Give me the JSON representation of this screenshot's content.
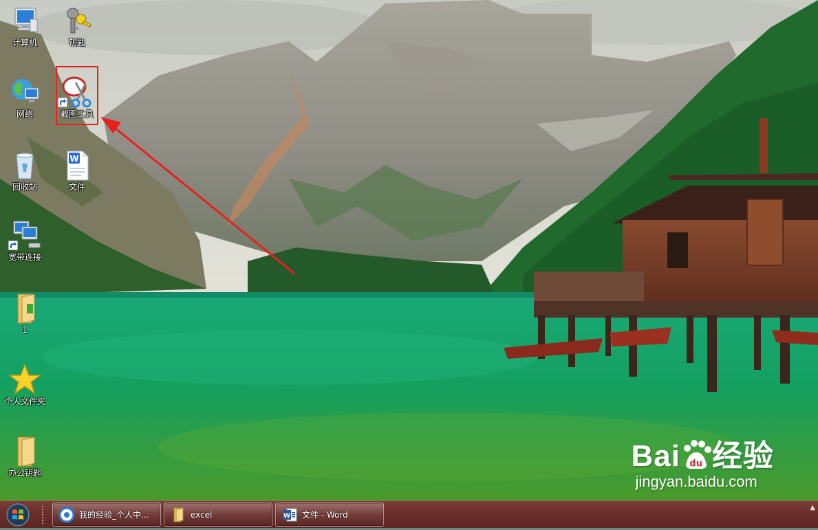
{
  "desktop": {
    "icons": [
      {
        "label": "计算机",
        "icon": "computer-icon"
      },
      {
        "label": "钥匙",
        "icon": "keys-icon"
      },
      {
        "label": "网络",
        "icon": "network-globe-icon"
      },
      {
        "label": "截图工具",
        "icon": "scissors-icon"
      },
      {
        "label": "回收站",
        "icon": "recycle-bin-icon"
      },
      {
        "label": "文件",
        "icon": "wps-word-document-icon"
      },
      {
        "label": "宽带连接",
        "icon": "broadband-connection-icon"
      },
      {
        "label": "1",
        "icon": "folder-icon"
      },
      {
        "label": "个人文件夹",
        "icon": "star-icon"
      },
      {
        "label": "办公钥匙",
        "icon": "folder-icon"
      }
    ]
  },
  "annotation": {
    "highlight_color": "#e8201e",
    "highlight_target": "截图工具"
  },
  "watermark": {
    "brand_prefix": "Bai",
    "brand_suffix": "经验",
    "site": "jingyan.baidu.com"
  },
  "taskbar": {
    "start": "start-orb-icon",
    "buttons": [
      {
        "label": "我的经验_个人中...",
        "icon": "browser-icon"
      },
      {
        "label": "excel",
        "icon": "folder-icon"
      },
      {
        "label": "文件 - Word",
        "icon": "word-icon"
      }
    ],
    "tray_arrow": "▲"
  },
  "colors": {
    "taskbar": "#6a2e2b",
    "lake": "#16a06a",
    "forest": "#1f6a2c"
  }
}
